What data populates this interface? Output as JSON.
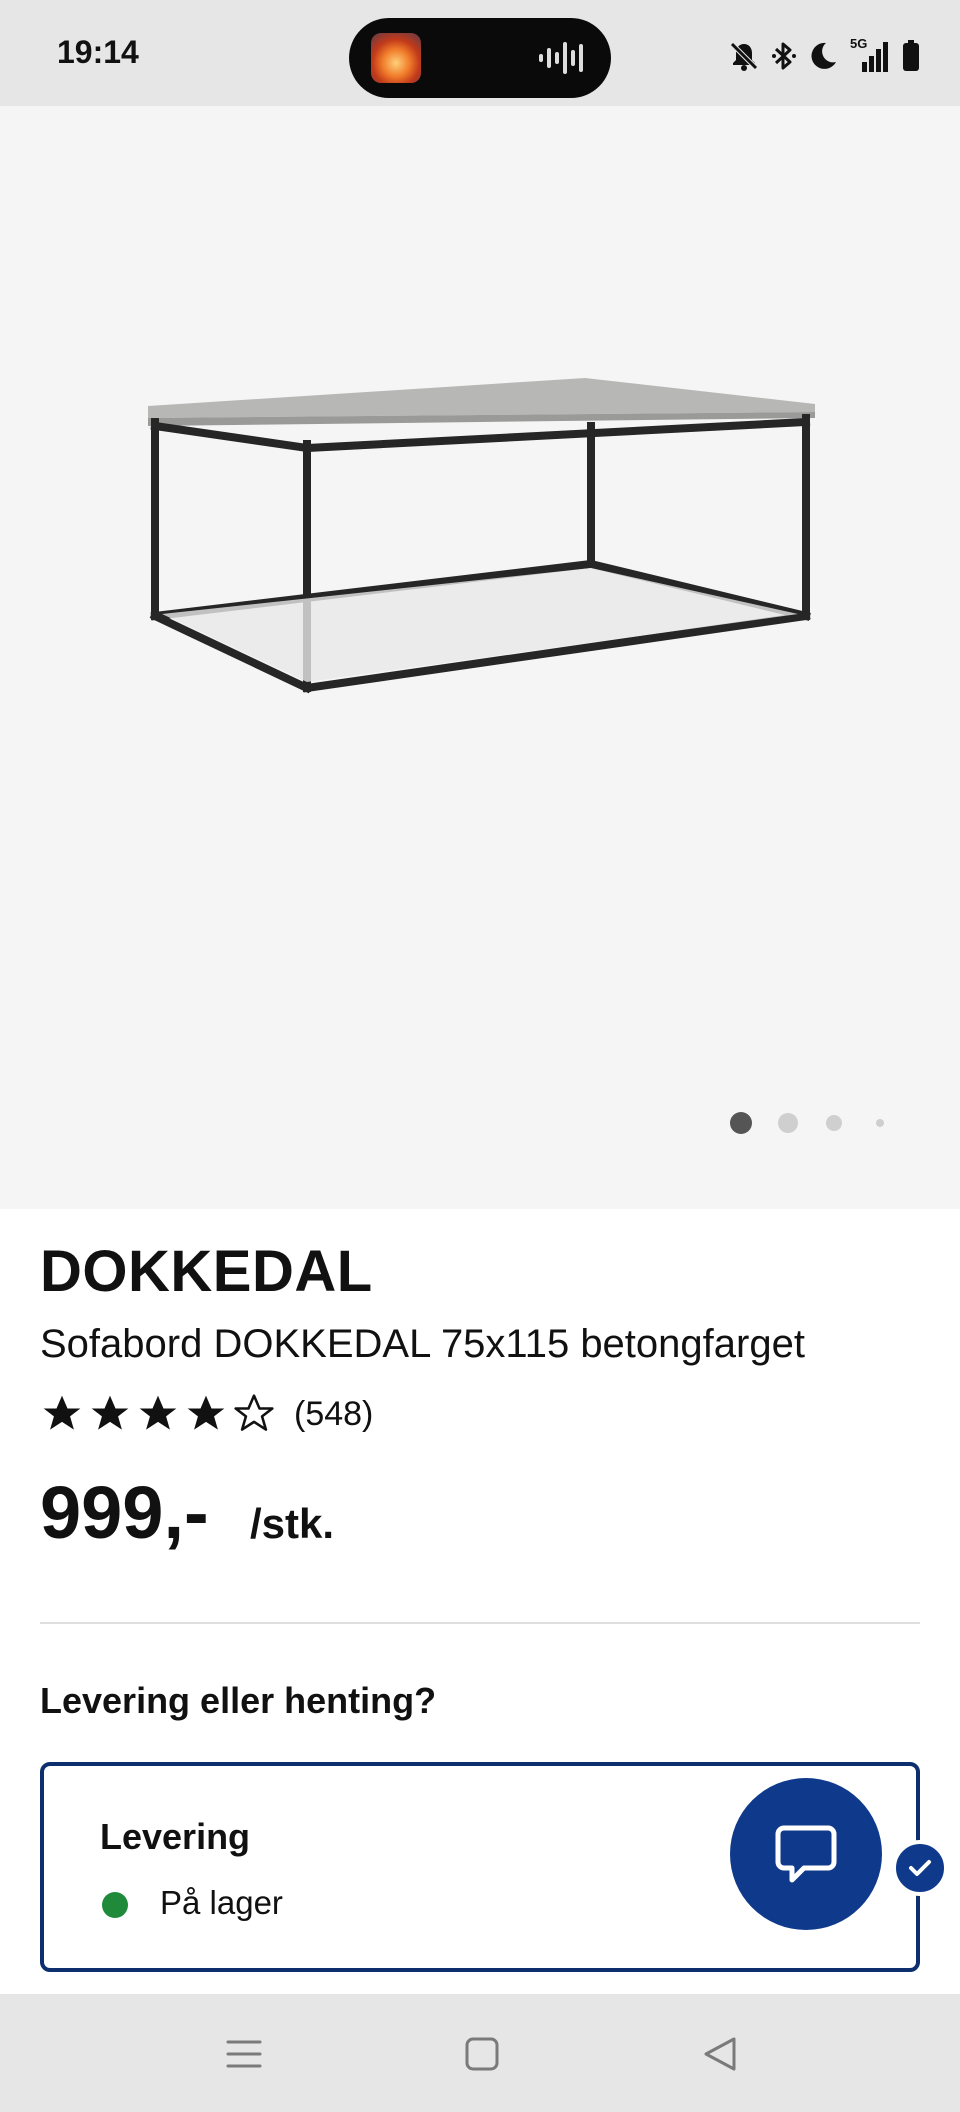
{
  "status_bar": {
    "time": "19:14",
    "icons": [
      "island-media-thumbnail",
      "audio-wave-icon",
      "mute-icon",
      "bluetooth-icon",
      "do-not-disturb-icon",
      "5g-signal-icon",
      "battery-icon"
    ],
    "network": "5G"
  },
  "product": {
    "image_alt": "DOKKEDAL sofabord",
    "image_pages": 4,
    "current_image": 1,
    "brand": "DOKKEDAL",
    "description": "Sofabord DOKKEDAL 75x115 betongfarget",
    "rating": 4,
    "rating_max": 5,
    "review_count": "(548)",
    "price": "999,-",
    "unit": "/stk."
  },
  "fulfilment": {
    "question": "Levering eller henting?",
    "delivery": {
      "title": "Levering",
      "stock_status": "På lager",
      "stock_color": "#1f8a3a",
      "selected": true
    }
  },
  "chat": {
    "icon": "chat-bubble-icon"
  },
  "nav_bar": {
    "items": [
      "menu-icon",
      "home-icon",
      "back-icon"
    ]
  },
  "colors": {
    "accent": "#0f3a8c",
    "card_border": "#0d2f6e",
    "hero_bg": "#f5f5f5"
  }
}
